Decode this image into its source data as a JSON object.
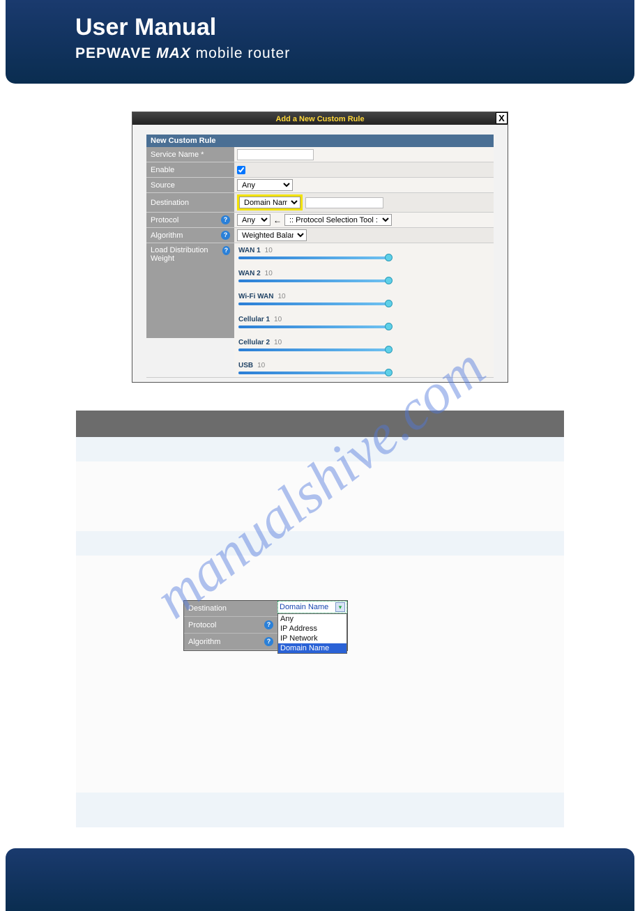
{
  "header": {
    "title": "User Manual",
    "brand_bold": "PEPWAVE",
    "brand_italic": "MAX",
    "brand_tail": "mobile router"
  },
  "watermark": "manualshive.com",
  "shot1": {
    "titlebar": "Add a New Custom Rule",
    "close": "X",
    "section": "New Custom Rule",
    "rows": {
      "service_name_label": "Service Name *",
      "service_name_value": "",
      "enable_label": "Enable",
      "enable_checked": true,
      "source_label": "Source",
      "source_value": "Any",
      "destination_label": "Destination",
      "destination_value": "Domain Name",
      "destination_extra": "",
      "protocol_label": "Protocol",
      "protocol_value": "Any",
      "protocol_tool": ":: Protocol Selection Tool ::",
      "algorithm_label": "Algorithm",
      "algorithm_value": "Weighted Balance",
      "ldw_label": "Load Distribution Weight",
      "ldw_items": [
        {
          "name": "WAN 1",
          "val": "10"
        },
        {
          "name": "WAN 2",
          "val": "10"
        },
        {
          "name": "Wi-Fi WAN",
          "val": "10"
        },
        {
          "name": "Cellular 1",
          "val": "10"
        },
        {
          "name": "Cellular 2",
          "val": "10"
        },
        {
          "name": "USB",
          "val": "10"
        }
      ]
    }
  },
  "shot2": {
    "destination_label": "Destination",
    "protocol_label": "Protocol",
    "algorithm_label": "Algorithm",
    "dd_selected": "Domain Name",
    "dd_options": [
      "Any",
      "IP Address",
      "IP Network",
      "Domain Name"
    ]
  }
}
